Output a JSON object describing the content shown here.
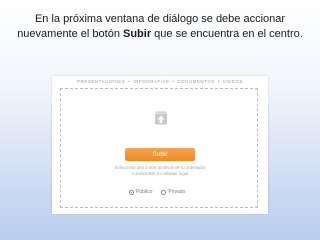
{
  "caption": {
    "before": "En la próxima ventana de diálogo se debe accionar nuevamente el botón ",
    "bold": "Subir",
    "after": " que se encuentra en el centro."
  },
  "dialog": {
    "tabs": [
      "PRESENTACIONES",
      "INFOGRAFÍAS",
      "DOCUMENTOS",
      "VIDEOS"
    ],
    "tab_separator": "•",
    "upload_icon": "cloud-upload-icon",
    "upload_button_label": "Subir",
    "hint_line1": "Selecciona uno o más archivos de tu ordenador",
    "hint_line2": "o arrástralos a cualquier lugar",
    "privacy": {
      "public_label": "Público",
      "private_label": "Privado",
      "selected": "public"
    },
    "accent_color": "#ee8a25"
  }
}
